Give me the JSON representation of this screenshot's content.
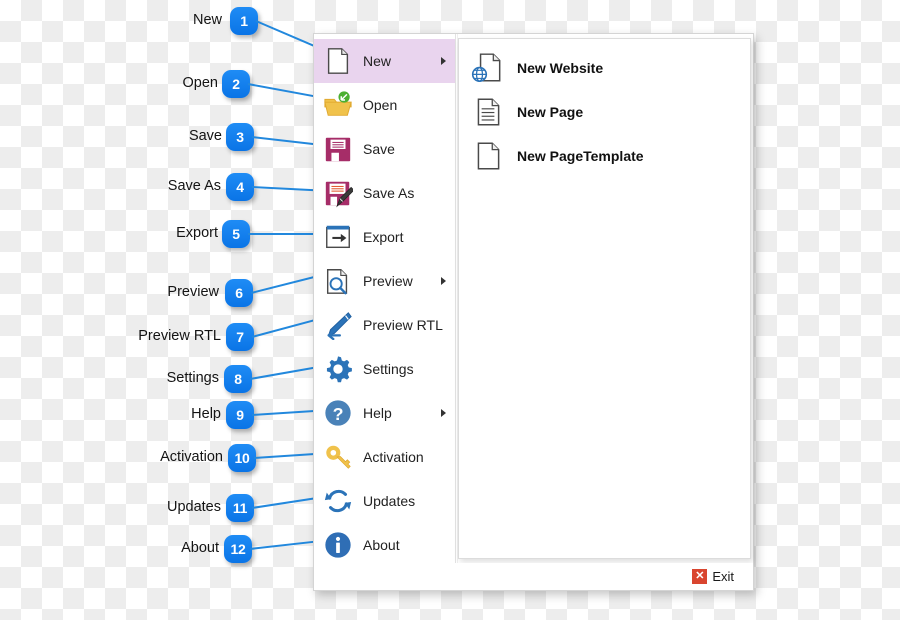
{
  "background": {
    "type": "transparency-checkerboard",
    "light": "#ffffff",
    "dark": "#ededed"
  },
  "callouts": [
    {
      "n": "1",
      "label": "New"
    },
    {
      "n": "2",
      "label": "Open"
    },
    {
      "n": "3",
      "label": "Save"
    },
    {
      "n": "4",
      "label": "Save As"
    },
    {
      "n": "5",
      "label": "Export"
    },
    {
      "n": "6",
      "label": "Preview"
    },
    {
      "n": "7",
      "label": "Preview RTL"
    },
    {
      "n": "8",
      "label": "Settings"
    },
    {
      "n": "9",
      "label": "Help"
    },
    {
      "n": "10",
      "label": "Activation"
    },
    {
      "n": "11",
      "label": "Updates"
    },
    {
      "n": "12",
      "label": "About"
    }
  ],
  "menu": {
    "items": [
      {
        "label": "New",
        "icon": "page-icon",
        "has_submenu": true,
        "selected": true
      },
      {
        "label": "Open",
        "icon": "folder-open-icon",
        "has_submenu": false,
        "selected": false
      },
      {
        "label": "Save",
        "icon": "floppy-disk-icon",
        "has_submenu": false,
        "selected": false
      },
      {
        "label": "Save As",
        "icon": "floppy-pencil-icon",
        "has_submenu": false,
        "selected": false
      },
      {
        "label": "Export",
        "icon": "export-arrow-icon",
        "has_submenu": false,
        "selected": false
      },
      {
        "label": "Preview",
        "icon": "page-search-icon",
        "has_submenu": true,
        "selected": false
      },
      {
        "label": "Preview RTL",
        "icon": "pencil-left-icon",
        "has_submenu": false,
        "selected": false
      },
      {
        "label": "Settings",
        "icon": "gear-icon",
        "has_submenu": false,
        "selected": false
      },
      {
        "label": "Help",
        "icon": "question-circle-icon",
        "has_submenu": true,
        "selected": false
      },
      {
        "label": "Activation",
        "icon": "key-icon",
        "has_submenu": false,
        "selected": false
      },
      {
        "label": "Updates",
        "icon": "refresh-icon",
        "has_submenu": false,
        "selected": false
      },
      {
        "label": "About",
        "icon": "info-circle-icon",
        "has_submenu": false,
        "selected": false
      }
    ]
  },
  "submenu": {
    "items": [
      {
        "label": "New Website",
        "icon": "page-globe-icon"
      },
      {
        "label": "New Page",
        "icon": "page-lines-icon"
      },
      {
        "label": "New PageTemplate",
        "icon": "page-blank-icon"
      }
    ]
  },
  "footer": {
    "exit_label": "Exit",
    "exit_glyph": "✕"
  },
  "colors": {
    "badge": "#0a74e6",
    "leader_line": "#2288dd",
    "selected_row": "#e9d4ee",
    "exit_red": "#d9452f",
    "icon_blue": "#2b73b8",
    "icon_magenta": "#a62d68",
    "icon_yellow": "#f0c24b"
  }
}
